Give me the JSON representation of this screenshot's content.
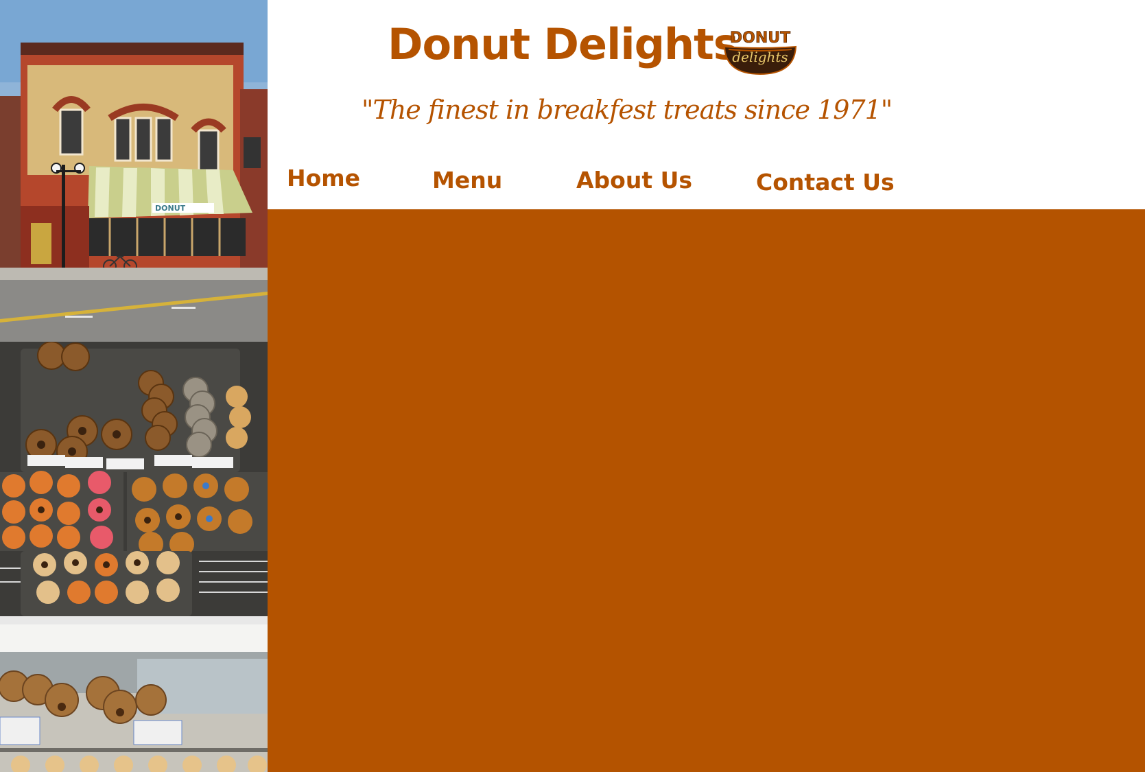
{
  "site": {
    "title": "Donut Delights",
    "tagline": "\"The finest in breakfest treats since 1971\"",
    "logo": {
      "top_text": "DONUT",
      "bottom_text": "delights"
    }
  },
  "nav": {
    "items": [
      {
        "label": "Home"
      },
      {
        "label": "Menu"
      },
      {
        "label": "About Us"
      },
      {
        "label": "Contact Us"
      }
    ]
  },
  "colors": {
    "brand": "#b55300",
    "content_background": "#b45300",
    "header_background": "#ffffff"
  },
  "photos": [
    {
      "name": "storefront-photo"
    },
    {
      "name": "donut-trays-photo"
    },
    {
      "name": "display-case-photo"
    }
  ]
}
